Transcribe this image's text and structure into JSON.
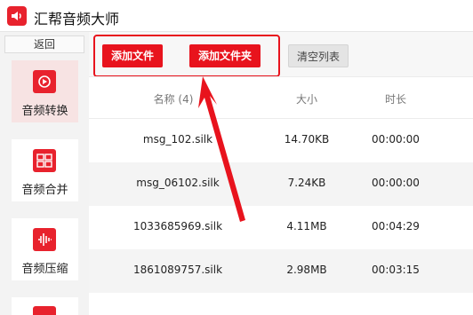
{
  "app": {
    "title": "汇帮音频大师",
    "logo_icon": "speaker-icon",
    "accent": "#e8131d"
  },
  "sidebar": {
    "back_label": "返回",
    "items": [
      {
        "label": "音频转换",
        "icon": "audio-convert-icon",
        "active": true
      },
      {
        "label": "音频合并",
        "icon": "audio-merge-icon",
        "active": false
      },
      {
        "label": "音频压缩",
        "icon": "audio-compress-icon",
        "active": false
      }
    ]
  },
  "toolbar": {
    "add_file_label": "添加文件",
    "add_folder_label": "添加文件夹",
    "clear_list_label": "清空列表"
  },
  "table": {
    "headers": {
      "name": "名称 (4)",
      "size": "大小",
      "duration": "时长"
    },
    "rows": [
      {
        "name": "msg_102.silk",
        "size": "14.70KB",
        "duration": "00:00:00"
      },
      {
        "name": "msg_06102.silk",
        "size": "7.24KB",
        "duration": "00:00:00"
      },
      {
        "name": "1033685969.silk",
        "size": "4.11MB",
        "duration": "00:04:29"
      },
      {
        "name": "1861089757.silk",
        "size": "2.98MB",
        "duration": "00:03:15"
      }
    ]
  }
}
